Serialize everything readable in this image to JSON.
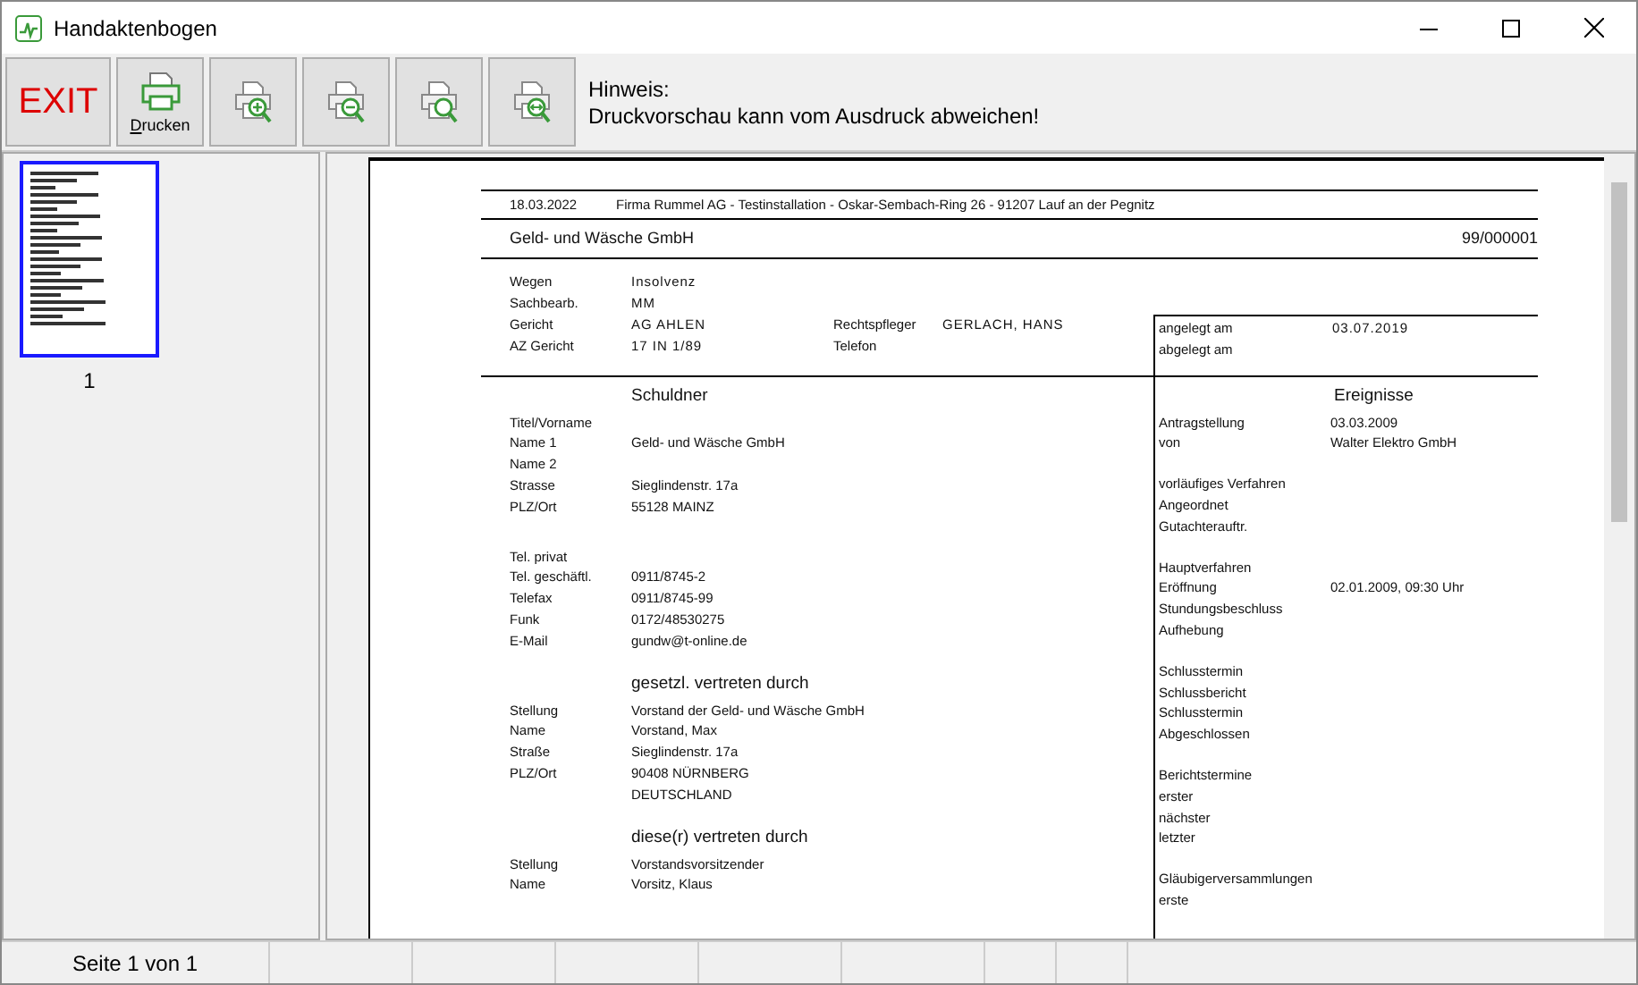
{
  "window": {
    "title": "Handaktenbogen"
  },
  "toolbar": {
    "buttons": [
      {
        "kind": "exit",
        "label": "EXIT"
      },
      {
        "kind": "print",
        "label": "Drucken"
      },
      {
        "kind": "zoom_in"
      },
      {
        "kind": "zoom_out"
      },
      {
        "kind": "zoom_fit"
      },
      {
        "kind": "zoom_width"
      }
    ],
    "hint": [
      "Hinweis:",
      "Druckvorschau kann vom Ausdruck abweichen!"
    ]
  },
  "thumbnails": [
    {
      "label": "1",
      "selected": true
    }
  ],
  "document": {
    "date": "18.03.2022",
    "company_line": "Firma Rummel AG - Testinstallation - Oskar-Sembach-Ring 26 - 91207 Lauf an der Pegnitz",
    "title": "Geld- und Wäsche GmbH",
    "number": "99/000001",
    "info": [
      {
        "label": "Wegen",
        "value": "Insolvenz"
      },
      {
        "label": "Sachbearb.",
        "value": "MM"
      },
      {
        "label": "Gericht",
        "value": "AG AHLEN",
        "label2": "Rechtspfleger",
        "value2": "GERLACH, HANS"
      },
      {
        "label": "AZ Gericht",
        "value": "17 IN 1/89",
        "label2": "Telefon"
      }
    ],
    "box": [
      {
        "label": "angelegt am",
        "value": "03.07.2019"
      },
      {
        "label": "abgelegt am"
      }
    ],
    "left": [
      {
        "heading": "Schuldner",
        "groups": [
          [
            {
              "label": "Titel/Vorname"
            },
            {
              "label": "Name 1",
              "value": "Geld- und Wäsche GmbH"
            },
            {
              "label": "Name 2"
            },
            {
              "label": "Strasse",
              "value": "Sieglindenstr. 17a"
            },
            {
              "label": "PLZ/Ort",
              "value": "55128 MAINZ"
            }
          ],
          [
            {
              "label": "Tel. privat"
            },
            {
              "label": "Tel. geschäftl.",
              "value": "0911/8745-2"
            },
            {
              "label": "Telefax",
              "value": "0911/8745-99"
            },
            {
              "label": "Funk",
              "value": "0172/48530275"
            },
            {
              "label": "E-Mail",
              "value": "gundw@t-online.de"
            }
          ]
        ]
      },
      {
        "heading": "gesetzl. vertreten durch",
        "groups": [
          [
            {
              "label": "Stellung",
              "value": "Vorstand der Geld- und Wäsche GmbH"
            },
            {
              "label": "Name",
              "value": "Vorstand, Max"
            },
            {
              "label": "Straße",
              "value": "Sieglindenstr. 17a"
            },
            {
              "label": "PLZ/Ort",
              "value": "90408 NÜRNBERG"
            },
            {
              "value": "DEUTSCHLAND"
            }
          ]
        ]
      },
      {
        "heading": "diese(r) vertreten durch",
        "groups": [
          [
            {
              "label": "Stellung",
              "value": "Vorstandsvorsitzender"
            },
            {
              "label": "Name",
              "value": "Vorsitz, Klaus"
            }
          ]
        ]
      }
    ],
    "right": {
      "heading": "Ereignisse",
      "groups": [
        [
          {
            "label": "Antragstellung",
            "value": "03.03.2009"
          },
          {
            "label": "von",
            "value": "Walter Elektro GmbH"
          }
        ],
        [
          {
            "label": "vorläufiges Verfahren"
          },
          {
            "label": "Angeordnet"
          },
          {
            "label": "Gutachterauftr."
          }
        ],
        [
          {
            "label": "Hauptverfahren"
          },
          {
            "label": "Eröffnung",
            "value": "02.01.2009, 09:30 Uhr"
          },
          {
            "label": "Stundungsbeschluss"
          },
          {
            "label": "Aufhebung"
          }
        ],
        [
          {
            "label": "Schlusstermin"
          },
          {
            "label": "Schlussbericht"
          },
          {
            "label": "Schlusstermin"
          },
          {
            "label": "Abgeschlossen"
          }
        ],
        [
          {
            "label": "Berichtstermine"
          },
          {
            "label": "erster"
          },
          {
            "label": "nächster"
          },
          {
            "label": "letzter"
          }
        ],
        [
          {
            "label": "Gläubigerversammlungen"
          },
          {
            "label": "erste"
          }
        ]
      ]
    }
  },
  "status_bar": {
    "page": "Seite 1 von 1"
  }
}
